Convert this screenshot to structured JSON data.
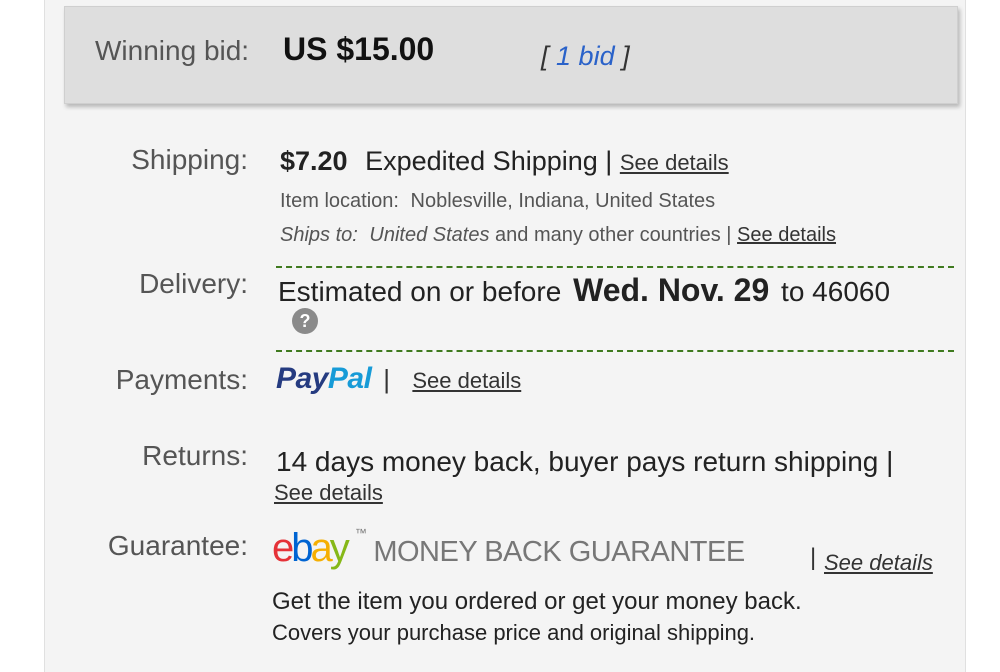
{
  "bid": {
    "label": "Winning bid:",
    "amount": "US $15.00",
    "count_open": "[",
    "count_link": "1 bid",
    "count_close": "]"
  },
  "shipping": {
    "label": "Shipping:",
    "price": "$7.20",
    "method": "Expedited Shipping",
    "sep": "|",
    "details": "See details",
    "location_label": "Item location:",
    "location_value": "Noblesville, Indiana, United States",
    "ships_to_label": "Ships to:",
    "ships_to_value": "United States",
    "ships_to_extra": "and many other countries",
    "ships_sep": "|",
    "ships_details": "See details"
  },
  "delivery": {
    "label": "Delivery:",
    "text_pre": "Estimated on or before",
    "date": "Wed. Nov. 29",
    "text_post": "to 46060",
    "help_icon": "?"
  },
  "payments": {
    "label": "Payments:",
    "paypal_pay": "Pay",
    "paypal_pal": "Pal",
    "sep": "|",
    "details": "See details"
  },
  "returns": {
    "label": "Returns:",
    "text": "14 days money back, buyer pays return shipping |",
    "details": "See details"
  },
  "guarantee": {
    "label": "Guarantee:",
    "ebay_e": "e",
    "ebay_b": "b",
    "ebay_a": "a",
    "ebay_y": "y",
    "tm": "™",
    "mbg": "MONEY BACK GUARANTEE",
    "sep": "|",
    "details": "See details",
    "line1": "Get the item you ordered or get your money back.",
    "line2": "Covers your purchase price and original shipping."
  },
  "colors": {
    "ebay_red": "#e53238",
    "ebay_blue": "#0064d2",
    "ebay_yellow": "#f5af02",
    "ebay_green": "#86b817",
    "paypal_dark": "#253b80",
    "paypal_light": "#179bd7",
    "dash_green": "#3f7a1f"
  }
}
